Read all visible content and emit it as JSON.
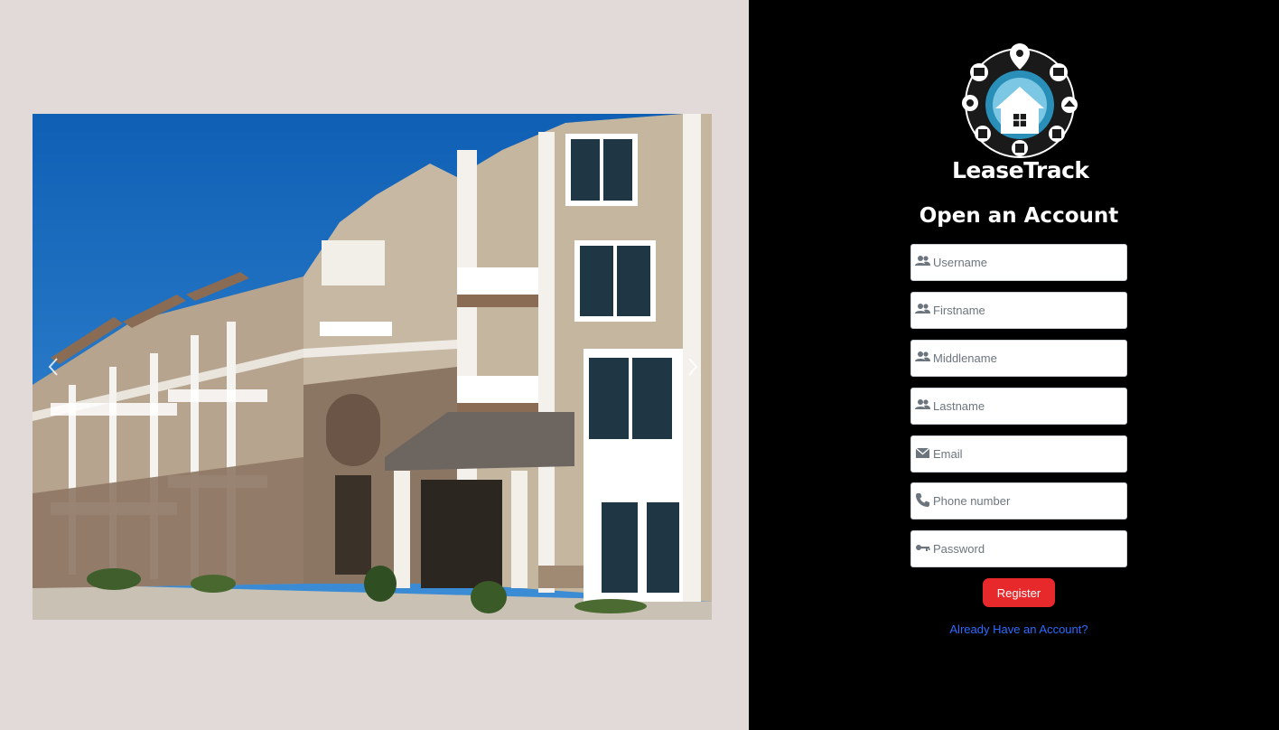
{
  "brand": {
    "name": "LeaseTrack",
    "logo_icon": "house-network-logo-icon"
  },
  "carousel": {
    "image_alt": "apartment-building-photo",
    "prev_icon": "chevron-left-icon",
    "next_icon": "chevron-right-icon"
  },
  "form": {
    "title": "Open an Account",
    "fields": [
      {
        "name": "username",
        "placeholder": "Username",
        "icon": "users-icon"
      },
      {
        "name": "firstname",
        "placeholder": "Firstname",
        "icon": "users-icon"
      },
      {
        "name": "middlename",
        "placeholder": "Middlename",
        "icon": "users-icon"
      },
      {
        "name": "lastname",
        "placeholder": "Lastname",
        "icon": "users-icon"
      },
      {
        "name": "email",
        "placeholder": "Email",
        "icon": "envelope-icon"
      },
      {
        "name": "phone",
        "placeholder": "Phone number",
        "icon": "phone-icon"
      },
      {
        "name": "password",
        "placeholder": "Password",
        "icon": "key-icon"
      }
    ],
    "register_label": "Register",
    "login_link": "Already Have an Account?"
  },
  "colors": {
    "left_bg": "#e2dad9",
    "right_bg": "#000000",
    "register_button": "#e8292c",
    "link": "#2c6bff"
  }
}
